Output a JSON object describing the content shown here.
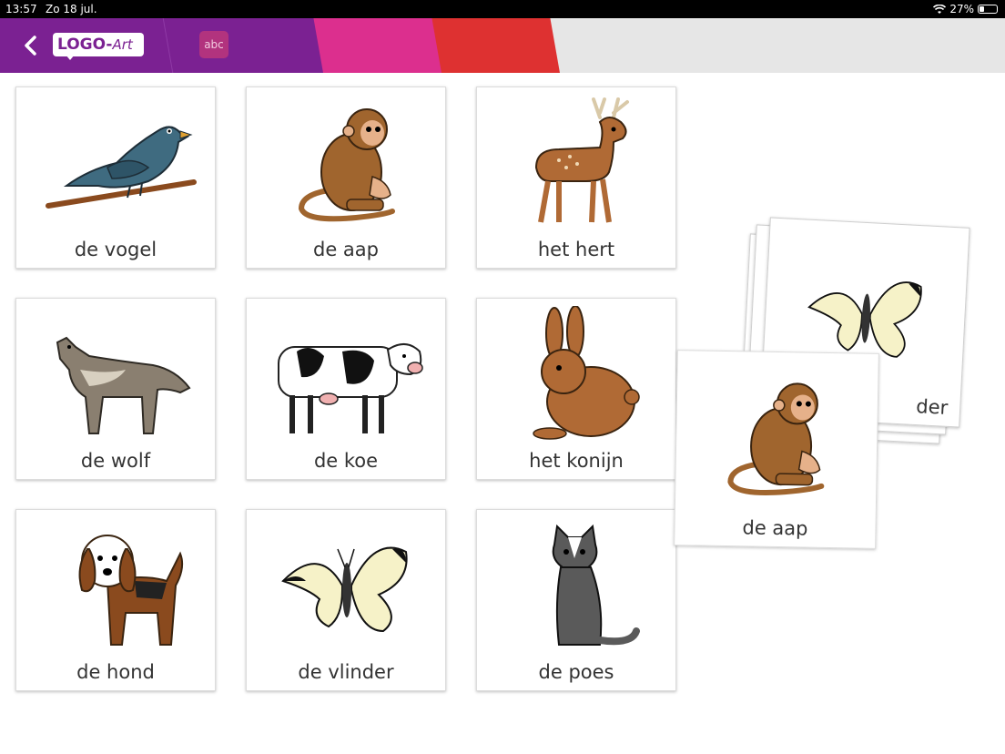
{
  "status_bar": {
    "time": "13:57",
    "date": "Zo 18 jul.",
    "battery": "27%",
    "battery_level": 0.27
  },
  "header": {
    "logo_main": "LOGO-",
    "logo_art": "Art",
    "abc_label": "abc"
  },
  "grid": [
    {
      "label": "de vogel",
      "icon": "bird-icon"
    },
    {
      "label": "de aap",
      "icon": "monkey-icon"
    },
    {
      "label": "het hert",
      "icon": "deer-icon"
    },
    {
      "label": "de wolf",
      "icon": "wolf-icon"
    },
    {
      "label": "de koe",
      "icon": "cow-icon"
    },
    {
      "label": "het konijn",
      "icon": "rabbit-icon"
    },
    {
      "label": "de hond",
      "icon": "dog-icon"
    },
    {
      "label": "de vlinder",
      "icon": "butterfly-icon"
    },
    {
      "label": "de poes",
      "icon": "cat-icon"
    }
  ],
  "stack": {
    "top_visible_text": "der",
    "top_icon": "butterfly-icon",
    "front_label": "de aap",
    "front_icon": "monkey-icon"
  },
  "colors": {
    "purple": "#7b2192",
    "pink": "#dc2f8e",
    "red": "#de3131"
  }
}
